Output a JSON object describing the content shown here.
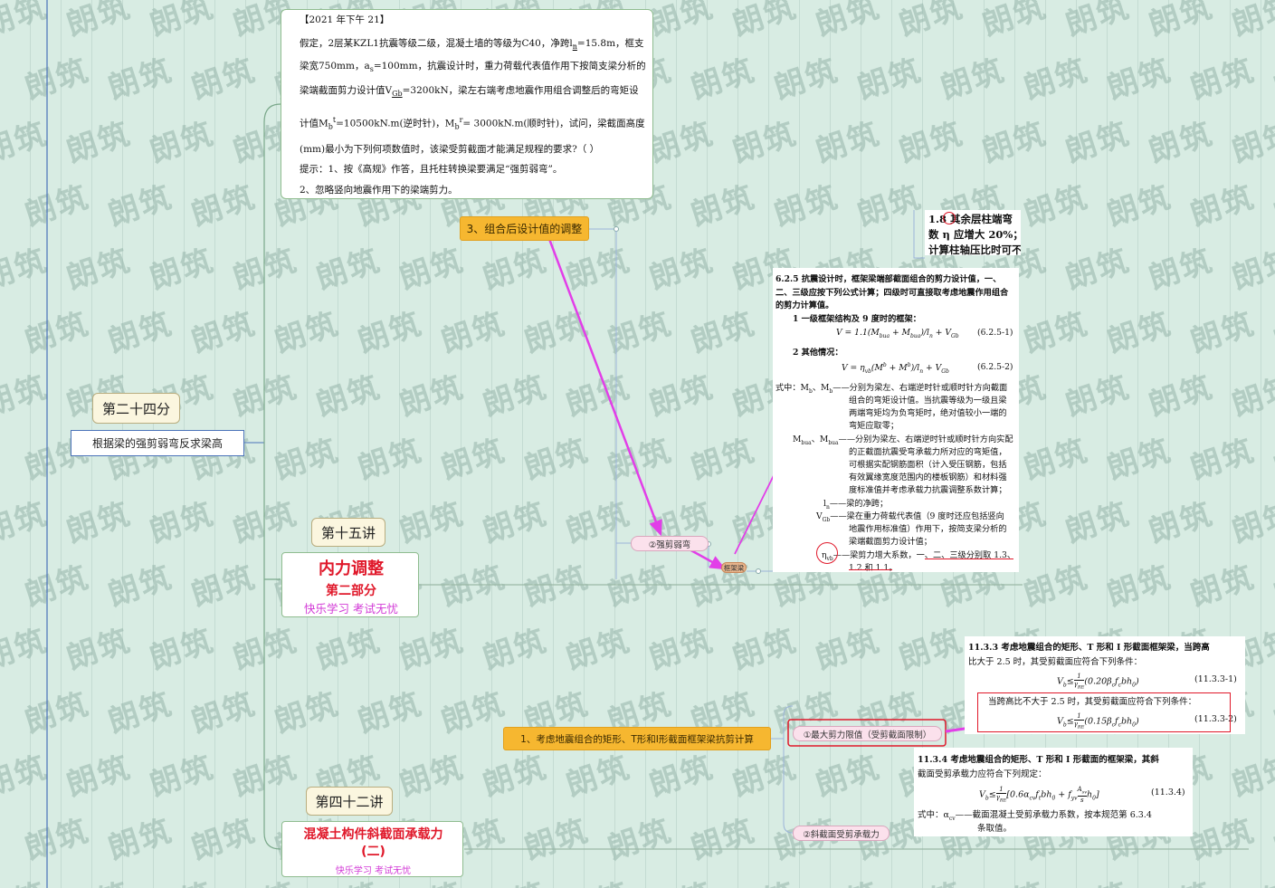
{
  "watermark": "朗筑",
  "colors": {
    "arrow": "#e23ee8",
    "accent_red": "#e0182a",
    "orange": "#f6b730",
    "link_line": "#5b9bd5"
  },
  "left": {
    "bubble_label": "第二十四分",
    "topic": "根据梁的强剪弱弯反求梁高"
  },
  "question": {
    "lines": [
      "【2021 年下午 21】",
      "假定，2层某KZL1抗震等级二级，混凝土墙的等级为C40，净跨l",
      "n",
      "=15.8m，框支",
      "梁宽750mm，a",
      "s",
      "=100mm，抗震设计时，重力荷载代表值作用下按简支梁分析的",
      "梁端截面剪力设计值V",
      "Gb",
      "=3200kN，梁左右端考虑地震作用组合调整后的弯矩设",
      "计值M",
      "b",
      "t",
      "=10500kN.m(逆时针)，M",
      "b",
      "r",
      "= 3000kN.m(顺时针)，试问，梁截面高度",
      "(mm)最小为下列何项数值时，该梁受剪截面才能满足规程的要求?（        ）",
      "提示：1、按《高规》作答，且托柱转换梁要满足“强剪弱弯”。",
      "2、忽略竖向地震作用下的梁端剪力。"
    ]
  },
  "nodes": {
    "combo_adjust": "3、组合后设计值的调整",
    "strong_shear": "②强剪弱弯",
    "frame_beam": "框架梁",
    "card15_header": "第十五讲",
    "card15_title": "内力调整",
    "card15_sub": "第二部分",
    "card15_slogan": "快乐学习  考试无忧",
    "card42_header": "第四十二讲",
    "card42_title": "混凝土构件斜截面承载力",
    "card42_title2": "(二)",
    "card42_slogan": "快乐学习  考试无忧",
    "shear_calc": "1、考虑地震组合的矩形、T形和I形截面框架梁抗剪计算",
    "max_shear": "①最大剪力限值（受剪截面限制）",
    "incline_shear": "②斜截面受剪承载力"
  },
  "top_right_clip": {
    "line1": "1.8 其余层柱端弯",
    "line2": "数 η   应增大 20%；",
    "line3": "计算柱轴压比时可不"
  },
  "code_625": {
    "heading": "6.2.5  抗震设计时，框架梁端部截面组合的剪力设计值，一、",
    "l2": "二、三级应按下列公式计算；四级时可直接取考虑地震作用组合",
    "l3": "的剪力计算值。",
    "i1": "1   一级框架结构及 9 度时的框架：",
    "eq1": "V = 1.1(M",
    "eq1b": "bua",
    "eq1c": " + M",
    "eq1d": "bua",
    "eq1e": ")/l",
    "eq1f": "n",
    "eq1g": " + V",
    "eq1h": "Gb",
    "eq1no": "(6.2.5-1)",
    "i2": "2   其他情况：",
    "eq2": "V = η",
    "eq2b": "vb",
    "eq2c": "(M",
    "eq2d": "b",
    "eq2e": " + M",
    "eq2f": "b",
    "eq2g": ")/l",
    "eq2h": "n",
    "eq2i": " + V",
    "eq2j": "Gb",
    "eq2no": "(6.2.5-2)",
    "w1": "式中：M",
    "w1b": "b",
    "w1c": "、M",
    "w1d": "b",
    "w1e": "——分别为梁左、右端逆时针或顺时针方向截面",
    "w2": "组合的弯矩设计值。当抗震等级为一级且梁",
    "w3": "两端弯矩均为负弯矩时，绝对值较小一端的",
    "w4": "弯矩应取零；",
    "w5": "M",
    "w5b": "bua",
    "w5c": "、M",
    "w5d": "bua",
    "w5e": "——分别为梁左、右端逆时针或顺时针方向实配",
    "w6": "的正截面抗震受弯承载力所对应的弯矩值，",
    "w7": "可根据实配钢筋面积（计入受压钢筋，包括",
    "w8": "有效翼缘宽度范围内的楼板钢筋）和材料强",
    "w9": "度标准值并考虑承载力抗震调整系数计算；",
    "w10": "l",
    "w10b": "n",
    "w10c": "——梁的净跨；",
    "w11": "V",
    "w11b": "Gb",
    "w11c": "——梁在重力荷载代表值（9 度时还应包括竖向",
    "w12": "地震作用标准值）作用下，按简支梁分析的",
    "w13": "梁端截面剪力设计值；",
    "w14": "η",
    "w14b": "vb",
    "w14c": "——梁剪力增大系数，一、二、三级分别取 1.3、",
    "w15": "1.2 和 1.1。"
  },
  "code_1133": {
    "l1": "11.3.3   考虑地震组合的矩形、T 形和 I 形截面框架梁，当跨高",
    "l2": "比大于 2.5 时，其受剪截面应符合下列条件：",
    "eqa": "V",
    "eqa_sub": "b",
    "eqa_rest": "≤",
    "eqa_frac_top": "1",
    "eqa_frac_bot": "γ",
    "eqa_frac_bot_sub": "RE",
    "eqa_body": "(0.20β",
    "eqa_body_sub": "c",
    "eqa_body2": "f",
    "eqa_body2_sub": "c",
    "eqa_body3": "bh",
    "eqa_body3_sub": "0",
    "eqa_body4": ")",
    "eqa_no": "(11.3.3-1)",
    "l3": "当跨高比不大于 2.5 时，其受剪截面应符合下列条件：",
    "eqb_body": "(0.15β",
    "eqb_no": "(11.3.3-2)"
  },
  "code_1134": {
    "l1": "11.3.4   考虑地震组合的矩形、T 形和 I 形截面的框架梁，其斜",
    "l2": "截面受剪承载力应符合下列规定：",
    "eq": "V",
    "eq_sub": "b",
    "eq_mid": "≤",
    "eq_frac_top": "1",
    "eq_frac_bot": "γ",
    "eq_frac_bot_sub": "RE",
    "eq_body": "[0.6α",
    "eq_body_sub": "cv",
    "eq_body2": "f",
    "eq_body2_sub": "t",
    "eq_body3": "bh",
    "eq_body3_sub": "0",
    "eq_body4": " + f",
    "eq_body4_sub": "yv",
    "eq_body5_top": "A",
    "eq_body5_top_sub": "sv",
    "eq_body5_bot": "s",
    "eq_body6": "h",
    "eq_body6_sub": "0",
    "eq_body7": "]",
    "eq_no": "(11.3.4)",
    "w1": "式中：α",
    "w1_sub": "cv",
    "w1b": "——截面混凝土受剪承载力系数，按本规范第 6.3.4",
    "w2": "条取值。"
  }
}
